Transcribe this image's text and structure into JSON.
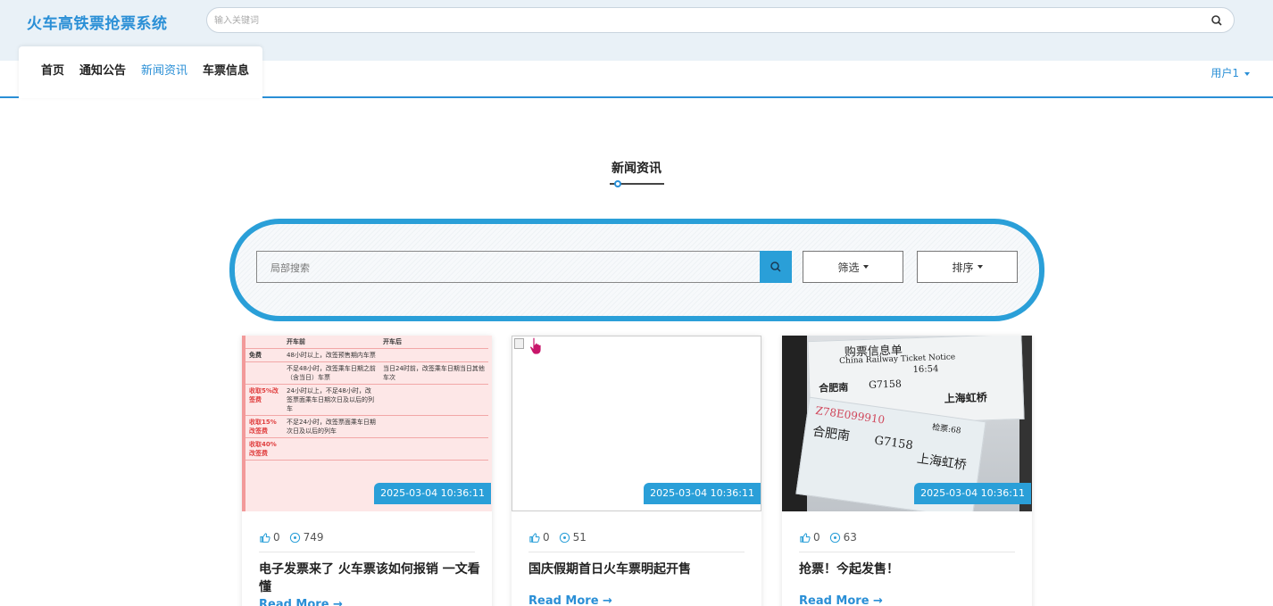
{
  "header": {
    "brand": "火车高铁票抢票系统",
    "search_placeholder": "输入关键词"
  },
  "nav": {
    "items": [
      {
        "label": "首页",
        "active": false
      },
      {
        "label": "通知公告",
        "active": false
      },
      {
        "label": "新闻资讯",
        "active": true
      },
      {
        "label": "车票信息",
        "active": false
      }
    ],
    "user": "用户1"
  },
  "section": {
    "title": "新闻资讯"
  },
  "filter": {
    "search_placeholder": "局部搜索",
    "filter_label": "筛选",
    "sort_label": "排序"
  },
  "cards": [
    {
      "date": "2025-03-04 10:36:11",
      "likes": "0",
      "views": "749",
      "title": "电子发票来了 火车票该如何报销 一文看懂",
      "more": "Read More →",
      "image_table": {
        "headers": [
          "",
          "开车前",
          "开车后"
        ],
        "rows": [
          [
            "免费",
            "48小时以上，改签预售期内车票",
            ""
          ],
          [
            "",
            "不足48小时，改签乘车日期之前（含当日）车票",
            "当日24时前，改签乘车日期当日其他车次"
          ],
          [
            "收取5%改签费",
            "24小时以上，不足48小时，改签票面乘车日期次日及以后的列车",
            ""
          ],
          [
            "收取15%改签费",
            "不足24小时，改签票面乘车日期次日及以后的列车",
            ""
          ],
          [
            "收取40%改签费",
            "",
            ""
          ]
        ]
      }
    },
    {
      "date": "2025-03-04 10:36:11",
      "likes": "0",
      "views": "51",
      "title": "国庆假期首日火车票明起开售",
      "more": "Read More →"
    },
    {
      "date": "2025-03-04 10:36:11",
      "likes": "0",
      "views": "63",
      "title": "抢票！今起发售！",
      "more": "Read More →",
      "image_text": {
        "header": "购票信息单",
        "sub": "China Railway Ticket Notice",
        "from": "合肥南",
        "train": "G7158",
        "to": "上海虹桥",
        "time": "16:54",
        "ticket_no": "Z78E099910",
        "gate": "检票:68"
      }
    }
  ],
  "colors": {
    "accent": "#2a9fd8",
    "brand": "#2a8fd6"
  }
}
